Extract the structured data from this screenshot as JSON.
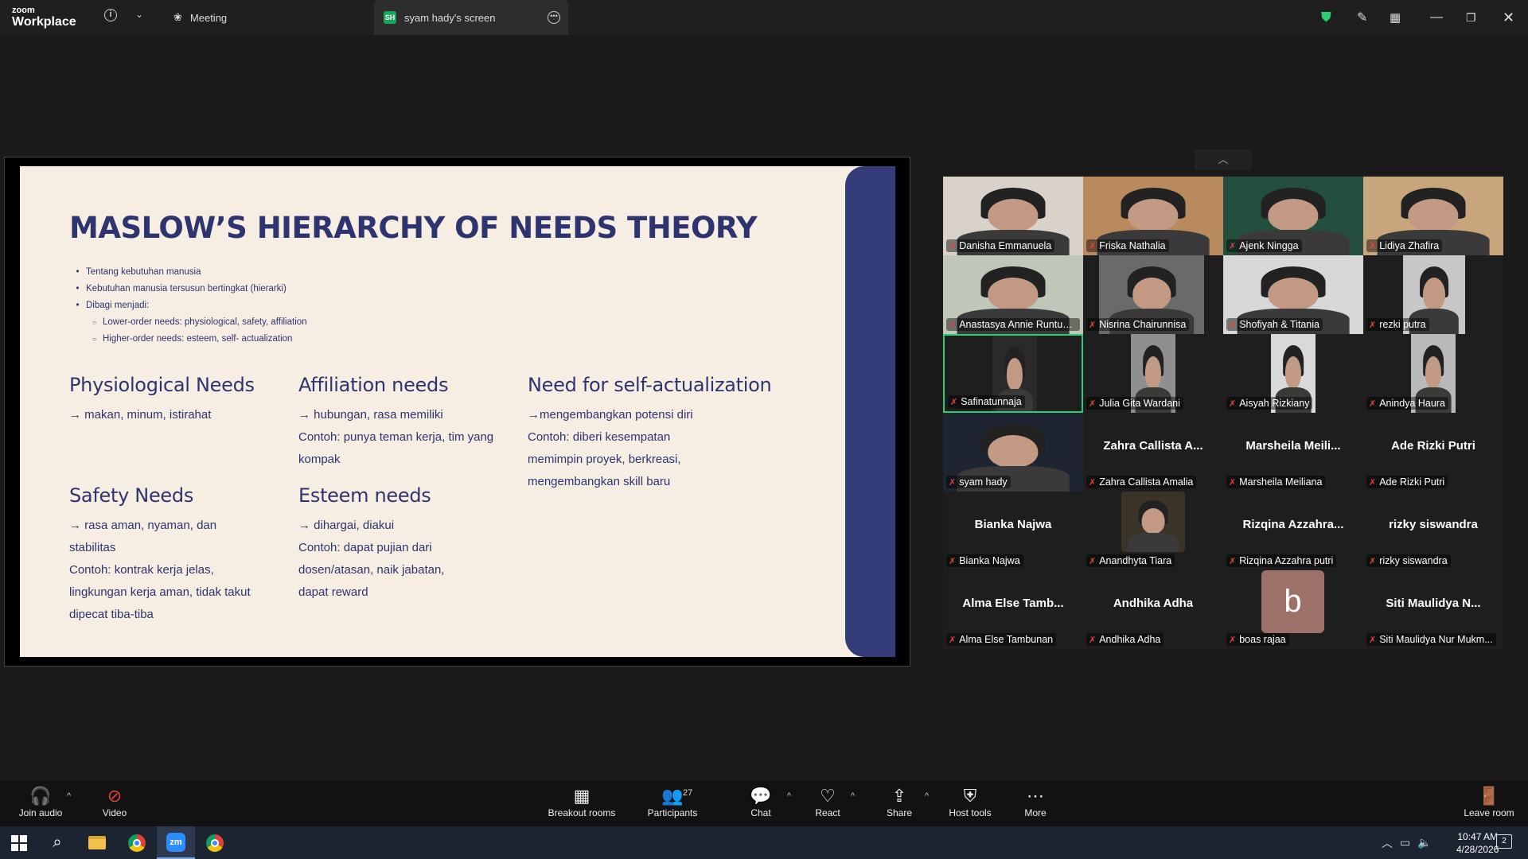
{
  "titlebar": {
    "logo_top": "zoom",
    "logo_bottom": "Workplace",
    "tab_meeting": "Meeting",
    "tab_screen_badge": "SH",
    "tab_screen": "syam hady's screen"
  },
  "slide": {
    "title": "MASLOW’S HIERARCHY OF NEEDS THEORY",
    "bullets": [
      "Tentang kebutuhan manusia",
      "Kebutuhan manusia tersusun bertingkat (hierarki)",
      "Dibagi menjadi:"
    ],
    "sub_bullets": [
      "Lower-order needs: physiological, safety, affiliation",
      "Higher-order needs: esteem, self- actualization"
    ],
    "needs": {
      "physiological": {
        "title": "Physiological Needs",
        "text": "→ makan, minum, istirahat"
      },
      "affiliation": {
        "title": "Affiliation needs",
        "text": "→ hubungan, rasa memiliki",
        "example": "Contoh: punya teman kerja, tim yang kompak"
      },
      "self_actualization": {
        "title": "Need for self-actualization",
        "text": "  →mengembangkan potensi diri",
        "example": "Contoh: diberi kesempatan memimpin proyek, berkreasi, mengembangkan skill baru"
      },
      "safety": {
        "title": "Safety Needs",
        "text": "→ rasa aman, nyaman, dan stabilitas",
        "example": "Contoh: kontrak kerja jelas, lingkungan kerja aman, tidak takut dipecat tiba-tiba"
      },
      "esteem": {
        "title": "Esteem needs",
        "text": "→ dihargai, diakui",
        "example": "Contoh: dapat pujian dari dosen/atasan, naik jabatan, dapat reward"
      }
    }
  },
  "participants": [
    {
      "label": "Danisha Emmanuela",
      "video": true
    },
    {
      "label": "Friska Nathalia",
      "video": true
    },
    {
      "label": "Ajenk Ningga",
      "video": true
    },
    {
      "label": "Lidiya Zhafira",
      "video": true
    },
    {
      "label": "Anastasya Annie Runtuw...",
      "video": true
    },
    {
      "label": "Nisrina Chairunnisa",
      "video": true
    },
    {
      "label": "Shofiyah & Titania",
      "video": true
    },
    {
      "label": "rezki putra",
      "video": true
    },
    {
      "label": "Safinatunnaja",
      "video": true,
      "active": true
    },
    {
      "label": "Julia Gita Wardani",
      "video": true
    },
    {
      "label": "Aisyah Rizkiany",
      "video": true
    },
    {
      "label": "Anindya Haura",
      "video": true
    },
    {
      "label": "syam hady",
      "video": true
    },
    {
      "label": "Zahra Callista Amalia",
      "big": "Zahra Callista A..."
    },
    {
      "label": "Marsheila Meiliana",
      "big": "Marsheila  Meili..."
    },
    {
      "label": "Ade Rizki Putri",
      "big": "Ade Rizki Putri"
    },
    {
      "label": "Bianka Najwa",
      "big": "Bianka Najwa"
    },
    {
      "label": "Anandhyta Tiara",
      "video": true
    },
    {
      "label": "Rizqina Azzahra putri",
      "big": "Rizqina  Azzahra..."
    },
    {
      "label": "rizky siswandra",
      "big": "rizky siswandra"
    },
    {
      "label": "Alma Else Tambunan",
      "big": "Alma Else Tamb..."
    },
    {
      "label": "Andhika Adha",
      "big": "Andhika Adha"
    },
    {
      "label": "boas rajaa",
      "avatar": "b"
    },
    {
      "label": "Siti Maulidya Nur Mukm...",
      "big": "Siti  Maulidya  N..."
    }
  ],
  "toolbar": {
    "join_audio": "Join audio",
    "video": "Video",
    "breakout": "Breakout rooms",
    "participants": "Participants",
    "participants_count": "27",
    "chat": "Chat",
    "react": "React",
    "share": "Share",
    "host_tools": "Host tools",
    "more": "More",
    "leave": "Leave room"
  },
  "taskbar": {
    "time": "10:47 AM",
    "date": "4/28/2026",
    "notifications": "2"
  },
  "colors": {
    "slide_bg": "#f6ede3",
    "slide_text": "#2e3470",
    "slide_band": "#353c7a",
    "active_speaker": "#2ecc71",
    "muted_mic": "#e0443a"
  }
}
